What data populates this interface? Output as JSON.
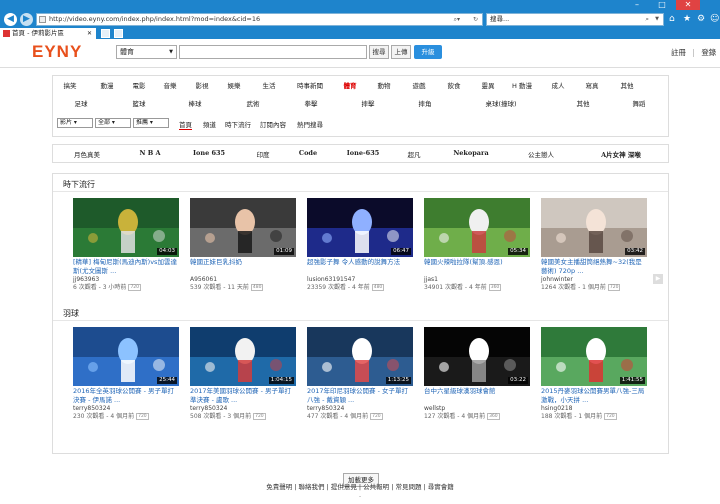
{
  "browser": {
    "url": "http://video.eyny.com/index.php/index.html?mod=index&cid=16",
    "search_text": "搜尋...",
    "tab_title": "首頁 - 伊莉影片區"
  },
  "header": {
    "logo": "EYNY",
    "category_select": "體育",
    "search_button": "搜尋",
    "upload_button": "上傳",
    "upgrade_button": "升級",
    "register": "註冊",
    "separator": "|",
    "login": "登錄"
  },
  "categories": {
    "row1": [
      "搞笑",
      "動漫",
      "電影",
      "音樂",
      "影視",
      "娛樂",
      "生活",
      "時事新聞",
      "體育",
      "動物",
      "遊戲",
      "飲食",
      "靈異",
      "H 動漫",
      "成人",
      "寫真",
      "其他"
    ],
    "row1_active": "體育",
    "row2": [
      "足球",
      "籃球",
      "棒球",
      "武術",
      "拳擊",
      "摔擊",
      "摔角",
      "桌球(撞球)",
      "其他",
      "舞蹈"
    ]
  },
  "filters": {
    "type": "影片",
    "scope": "全部",
    "sort": "推薦",
    "tabs": [
      "首頁",
      "頻道",
      "時下流行",
      "訂閱內容",
      "熱門搜尋"
    ],
    "active_tab": "首頁"
  },
  "tags": [
    "月色真美",
    "N B A",
    "Ione 635",
    "印度",
    "Code",
    "Ione-635",
    "超凡",
    "Nekopara",
    "公主戀人",
    "A片女神 深喉"
  ],
  "sections": [
    {
      "title": "時下流行",
      "videos": [
        {
          "title": "[精華] 梅甸尼斯(馬迪內斯)vs加雲達斯(尤文圖斯 ...",
          "user": "jj963963",
          "stats": "6 次觀看 - 3 小時前",
          "badge": "720",
          "duration": "04:03"
        },
        {
          "title": "韓國正妹巨乳抖奶",
          "user": "A956061",
          "stats": "539 次觀看 - 11 天前",
          "badge": "480",
          "duration": "01:09"
        },
        {
          "title": "超強影子舞 令人感動的說舞方法",
          "user": "lusion63191547",
          "stats": "23359 次觀看 - 4 年前",
          "badge": "480",
          "duration": "06:47"
        },
        {
          "title": "韓國火辣啦拉隊(幫頂.感恩)",
          "user": "jjas1",
          "stats": "34901 次觀看 - 4 年前",
          "badge": "360",
          "duration": "05:34"
        },
        {
          "title": "韓國美女主播甜筒絕熱舞~32(我是藝術) 720p ...",
          "user": "johnwinter",
          "stats": "1264 次觀看 - 1 個月前",
          "badge": "720",
          "duration": "03:42"
        }
      ]
    },
    {
      "title": "羽球",
      "videos": [
        {
          "title": "2016年全英羽球公開賽 - 男子單打決賽 - 伊馬諾 ...",
          "user": "terry850324",
          "stats": "230 次觀看 - 4 個月前",
          "badge": "720",
          "duration": "25:44"
        },
        {
          "title": "2017年美國羽球公開賽 - 男子單打準決賽 - 盧歌 ...",
          "user": "terry850324",
          "stats": "508 次觀看 - 3 個月前",
          "badge": "720",
          "duration": "1:04:15"
        },
        {
          "title": "2017年印尼羽球公開賽 - 女子單打八強 - 戴資穎 ...",
          "user": "terry850324",
          "stats": "477 次觀看 - 4 個月前",
          "badge": "720",
          "duration": "1:13:25"
        },
        {
          "title": "台中六星級球漢羽球會館",
          "user": "wellstp",
          "stats": "127 次觀看 - 4 個月前",
          "badge": "360",
          "duration": "03:22"
        },
        {
          "title": "2015丹麥羽球公開賽男單八強-三局激戰，小天拼 ...",
          "user": "hsing0218",
          "stats": "188 次觀看 - 1 個月前",
          "badge": "720",
          "duration": "1:41:55"
        }
      ]
    }
  ],
  "load_more": "加載更多",
  "footer": {
    "links": "免責聲明 | 聯絡我們 | 提供意見 | 公共報明 | 常見問題 | 尋實會籍",
    "sub": "-"
  }
}
